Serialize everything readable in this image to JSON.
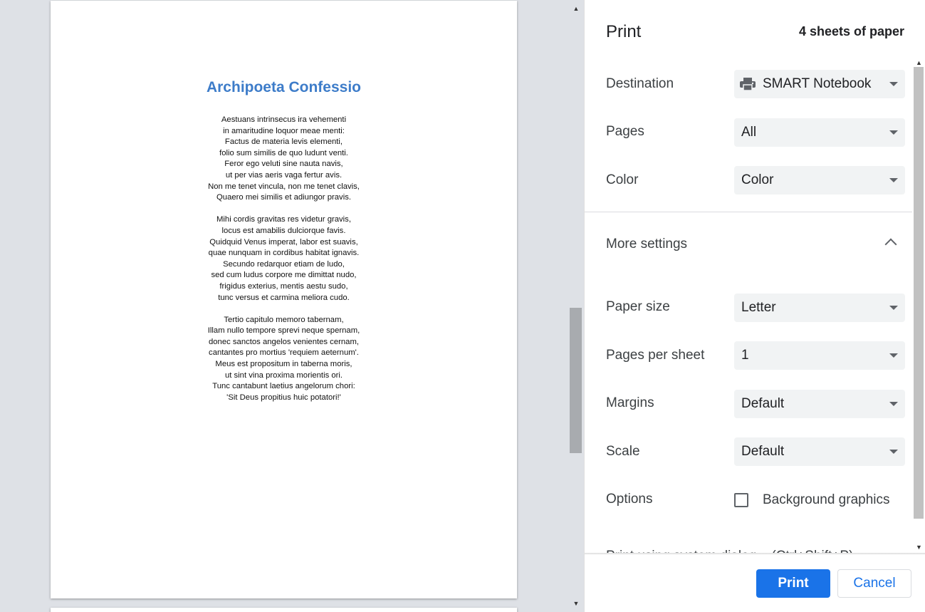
{
  "preview": {
    "document_title": "Archipoeta Confessio",
    "stanzas": [
      [
        "Aestuans intrinsecus ira vehementi",
        "in amaritudine loquor meae menti:",
        "Factus de materia levis elementi,",
        "folio sum similis de quo ludunt venti.",
        "Feror ego veluti sine nauta navis,",
        "ut per vias aeris vaga fertur avis.",
        "Non me tenet vincula, non me tenet clavis,",
        "Quaero mei similis et adiungor pravis."
      ],
      [
        "Mihi cordis gravitas res videtur gravis,",
        "locus est amabilis dulciorque favis.",
        "Quidquid Venus imperat, labor est suavis,",
        "quae nunquam in cordibus habitat ignavis.",
        "Secundo redarquor etiam de ludo,",
        "sed cum ludus corpore me dimittat nudo,",
        "frigidus exterius, mentis aestu sudo,",
        "tunc versus et carmina meliora cudo."
      ],
      [
        "Tertio capitulo memoro tabernam,",
        "Illam nullo tempore sprevi neque spernam,",
        "donec sanctos angelos venientes cernam,",
        "cantantes pro mortius 'requiem aeternum'.",
        "Meus est propositum in taberna moris,",
        "ut sint vina proxima morientis ori.",
        "Tunc cantabunt laetius angelorum chori:",
        "'Sit Deus propitius huic potatori!'"
      ]
    ]
  },
  "panel": {
    "title": "Print",
    "sheets": "4 sheets of paper",
    "destination": {
      "label": "Destination",
      "value": "SMART Notebook",
      "icon": "printer-icon"
    },
    "pages": {
      "label": "Pages",
      "value": "All"
    },
    "color": {
      "label": "Color",
      "value": "Color"
    },
    "more_settings": "More settings",
    "paper_size": {
      "label": "Paper size",
      "value": "Letter"
    },
    "pages_per_sheet": {
      "label": "Pages per sheet",
      "value": "1"
    },
    "margins": {
      "label": "Margins",
      "value": "Default"
    },
    "scale": {
      "label": "Scale",
      "value": "Default"
    },
    "options": {
      "label": "Options",
      "background_graphics": "Background graphics",
      "checked": false
    },
    "system_dialog": "Print using system dialog... (Ctrl+Shift+P)",
    "print_button": "Print",
    "cancel_button": "Cancel"
  },
  "colors": {
    "accent": "#1a73e8",
    "title_blue": "#3d7cc9"
  }
}
